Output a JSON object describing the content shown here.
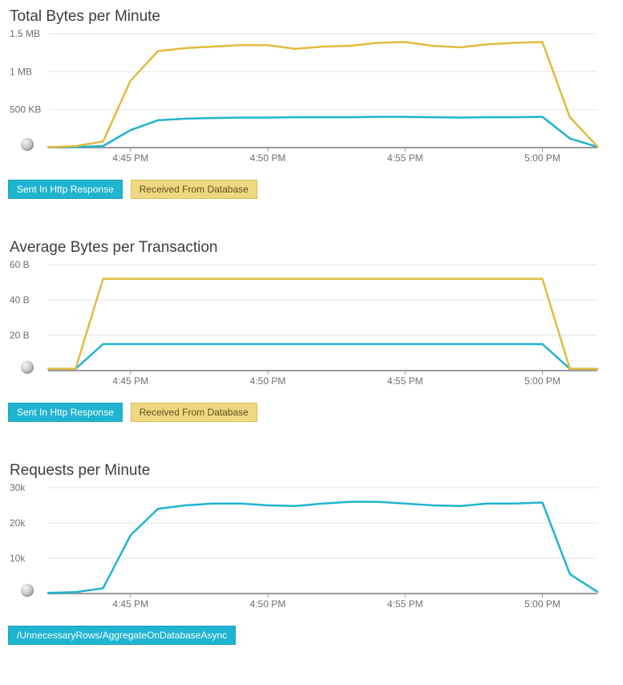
{
  "colors": {
    "blue": "#1fb4d0",
    "gold": "#e1bb3f"
  },
  "chart_data": [
    {
      "id": "total-bytes",
      "type": "line",
      "title": "Total Bytes per Minute",
      "xlabel": "",
      "ylabel": "",
      "x_ticks": [
        "4:45 PM",
        "4:50 PM",
        "4:55 PM",
        "5:00 PM"
      ],
      "y_ticks": [
        "500 KB",
        "1 MB",
        "1.5 MB"
      ],
      "ylim_kb": [
        0,
        1500
      ],
      "xlim": [
        42,
        62
      ],
      "legend": [
        "Sent In Http Response",
        "Received From Database"
      ],
      "series": [
        {
          "name": "Sent In Http Response",
          "color": "blue",
          "x": [
            42,
            43,
            44,
            45,
            46,
            47,
            48,
            49,
            50,
            51,
            52,
            53,
            54,
            55,
            56,
            57,
            58,
            59,
            60,
            61,
            62
          ],
          "y_kb": [
            5,
            8,
            20,
            230,
            360,
            380,
            390,
            395,
            395,
            400,
            400,
            400,
            405,
            405,
            400,
            395,
            400,
            400,
            405,
            120,
            10
          ]
        },
        {
          "name": "Received From Database",
          "color": "gold",
          "x": [
            42,
            43,
            44,
            45,
            46,
            47,
            48,
            49,
            50,
            51,
            52,
            53,
            54,
            55,
            56,
            57,
            58,
            59,
            60,
            61,
            62
          ],
          "y_kb": [
            5,
            20,
            80,
            880,
            1270,
            1310,
            1330,
            1350,
            1350,
            1300,
            1330,
            1340,
            1380,
            1390,
            1340,
            1320,
            1360,
            1380,
            1390,
            400,
            15
          ]
        }
      ]
    },
    {
      "id": "avg-bytes",
      "type": "line",
      "title": "Average Bytes per Transaction",
      "xlabel": "",
      "ylabel": "",
      "x_ticks": [
        "4:45 PM",
        "4:50 PM",
        "4:55 PM",
        "5:00 PM"
      ],
      "y_ticks": [
        "20 B",
        "40 B",
        "60 B"
      ],
      "ylim_b": [
        0,
        60
      ],
      "xlim": [
        42,
        62
      ],
      "legend": [
        "Sent In Http Response",
        "Received From Database"
      ],
      "series": [
        {
          "name": "Sent In Http Response",
          "color": "blue",
          "x": [
            42,
            43,
            44,
            59,
            60,
            61,
            62
          ],
          "y_b": [
            1,
            1,
            15,
            15,
            15,
            1,
            1
          ]
        },
        {
          "name": "Received From Database",
          "color": "gold",
          "x": [
            42,
            43,
            44,
            59,
            60,
            61,
            62
          ],
          "y_b": [
            1,
            1,
            52,
            52,
            52,
            1,
            1
          ]
        }
      ]
    },
    {
      "id": "requests",
      "type": "line",
      "title": "Requests per Minute",
      "xlabel": "",
      "ylabel": "",
      "x_ticks": [
        "4:45 PM",
        "4:50 PM",
        "4:55 PM",
        "5:00 PM"
      ],
      "y_ticks": [
        "10k",
        "20k",
        "30k"
      ],
      "ylim_k": [
        0,
        30
      ],
      "xlim": [
        42,
        62
      ],
      "legend": [
        "/UnnecessaryRows/AggregateOnDatabaseAsync"
      ],
      "series": [
        {
          "name": "/UnnecessaryRows/AggregateOnDatabaseAsync",
          "color": "blue",
          "x": [
            42,
            43,
            44,
            45,
            46,
            47,
            48,
            49,
            50,
            51,
            52,
            53,
            54,
            55,
            56,
            57,
            58,
            59,
            60,
            61,
            62
          ],
          "y_k": [
            0.2,
            0.4,
            1.5,
            16.5,
            24,
            25,
            25.5,
            25.5,
            25,
            24.8,
            25.5,
            26,
            26,
            25.5,
            25,
            24.8,
            25.5,
            25.5,
            25.8,
            5.5,
            0.5
          ]
        }
      ]
    }
  ]
}
